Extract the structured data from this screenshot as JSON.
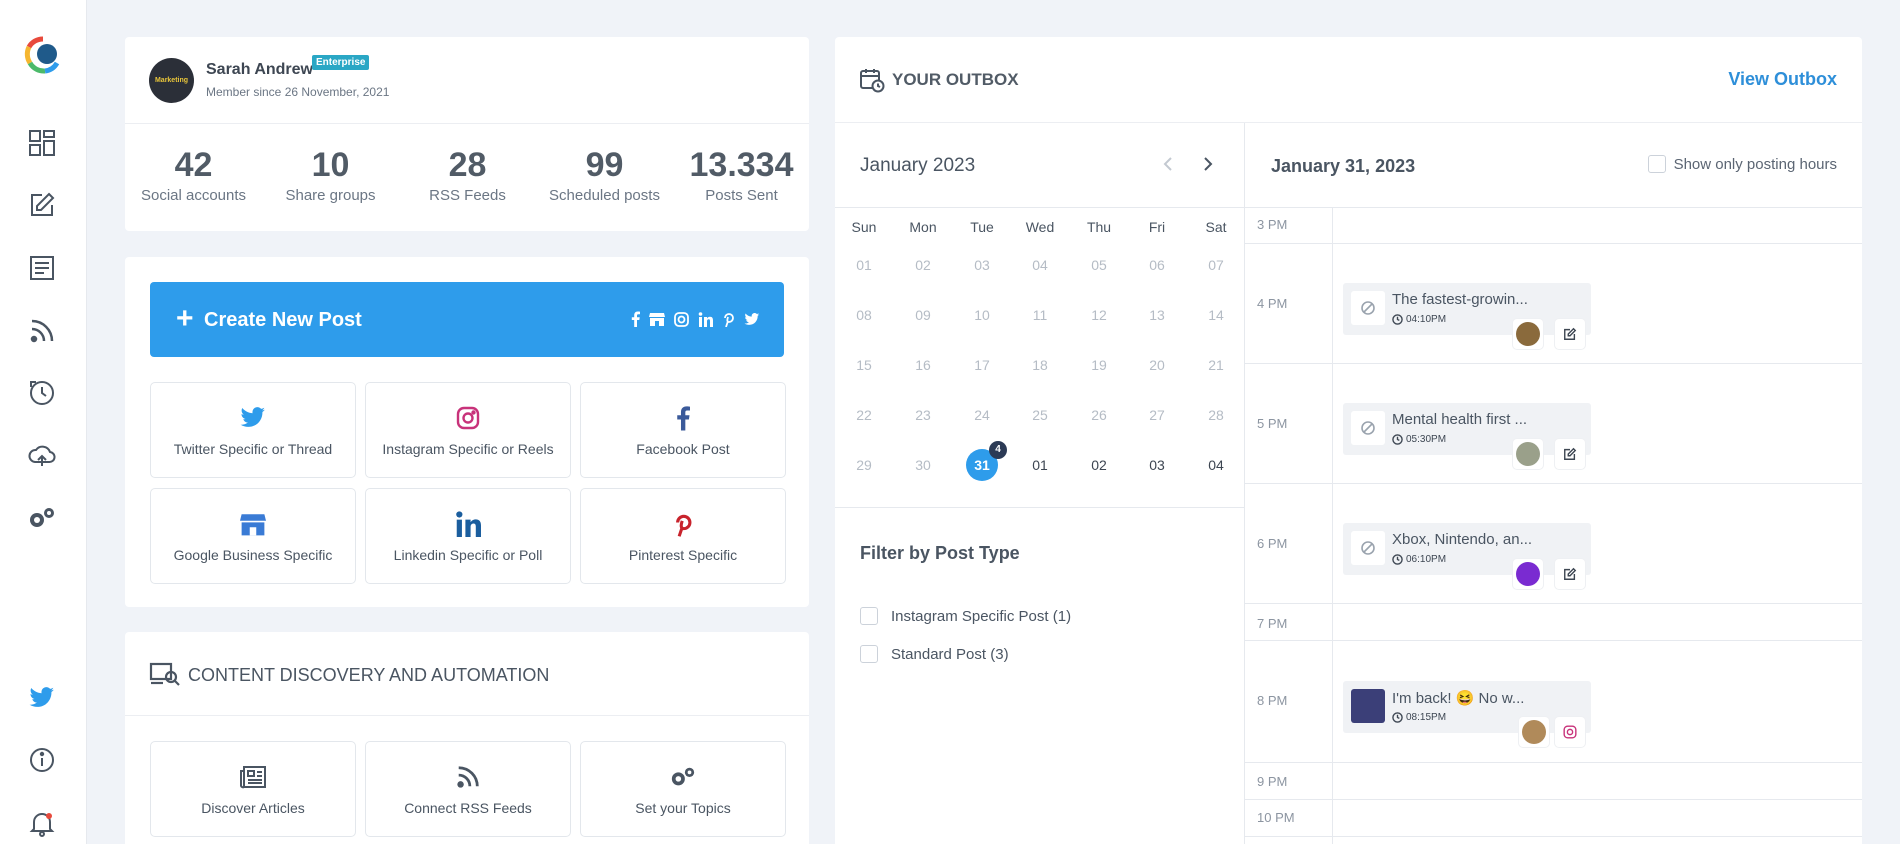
{
  "sidebar": {
    "items": [
      {
        "icon": "dashboard-icon"
      },
      {
        "icon": "compose-icon"
      },
      {
        "icon": "articles-icon"
      },
      {
        "icon": "rss-icon"
      },
      {
        "icon": "schedule-icon"
      },
      {
        "icon": "cloud-upload-icon"
      },
      {
        "icon": "settings-icon"
      }
    ],
    "bottom": [
      {
        "icon": "twitter-icon"
      },
      {
        "icon": "info-icon"
      },
      {
        "icon": "notification-bell-icon"
      }
    ]
  },
  "profile": {
    "name": "Sarah Andrew",
    "badge": "Enterprise",
    "member_since": "Member since 26 November, 2021",
    "avatar_text": "Marketing",
    "stats": [
      {
        "value": "42",
        "label": "Social accounts"
      },
      {
        "value": "10",
        "label": "Share groups"
      },
      {
        "value": "28",
        "label": "RSS Feeds"
      },
      {
        "value": "99",
        "label": "Scheduled posts"
      },
      {
        "value": "13.334",
        "label": "Posts Sent"
      }
    ]
  },
  "create": {
    "label": "Create New Post",
    "plus": "+",
    "tiles": [
      {
        "label": "Twitter Specific or Thread",
        "icon": "twitter-icon"
      },
      {
        "label": "Instagram Specific or Reels",
        "icon": "instagram-icon"
      },
      {
        "label": "Facebook Post",
        "icon": "facebook-icon"
      },
      {
        "label": "Google Business Specific",
        "icon": "google-business-icon"
      },
      {
        "label": "Linkedin Specific or Poll",
        "icon": "linkedin-icon"
      },
      {
        "label": "Pinterest Specific",
        "icon": "pinterest-icon"
      }
    ]
  },
  "discovery": {
    "title": "CONTENT DISCOVERY AND AUTOMATION",
    "tiles": [
      {
        "label": "Discover Articles",
        "icon": "newspaper-icon"
      },
      {
        "label": "Connect RSS Feeds",
        "icon": "rss-icon"
      },
      {
        "label": "Set your Topics",
        "icon": "gears-icon"
      }
    ]
  },
  "outbox": {
    "title": "YOUR OUTBOX",
    "view_link": "View Outbox",
    "calendar": {
      "month": "January 2023",
      "weekdays": [
        "Sun",
        "Mon",
        "Tue",
        "Wed",
        "Thu",
        "Fri",
        "Sat"
      ],
      "weeks": [
        [
          "01",
          "02",
          "03",
          "04",
          "05",
          "06",
          "07"
        ],
        [
          "08",
          "09",
          "10",
          "11",
          "12",
          "13",
          "14"
        ],
        [
          "15",
          "16",
          "17",
          "18",
          "19",
          "20",
          "21"
        ],
        [
          "22",
          "23",
          "24",
          "25",
          "26",
          "27",
          "28"
        ],
        [
          "29",
          "30",
          "31",
          "01",
          "02",
          "03",
          "04"
        ]
      ],
      "selected_day": "31",
      "selected_count": "4"
    },
    "filter": {
      "title": "Filter by Post Type",
      "options": [
        "Instagram Specific Post (1)",
        "Standard Post (3)"
      ]
    },
    "day": {
      "date": "January 31, 2023",
      "show_only": "Show only posting hours",
      "hours": [
        "3 PM",
        "4 PM",
        "5 PM",
        "6 PM",
        "7 PM",
        "8 PM",
        "9 PM",
        "10 PM"
      ],
      "posts": [
        {
          "text": "The fastest-growin...",
          "time": "04:10PM"
        },
        {
          "text": "Mental health first ...",
          "time": "05:30PM"
        },
        {
          "text": "Xbox, Nintendo, an...",
          "time": "06:10PM"
        },
        {
          "text": "I'm back! 😆 No w...",
          "time": "08:15PM"
        }
      ]
    }
  }
}
